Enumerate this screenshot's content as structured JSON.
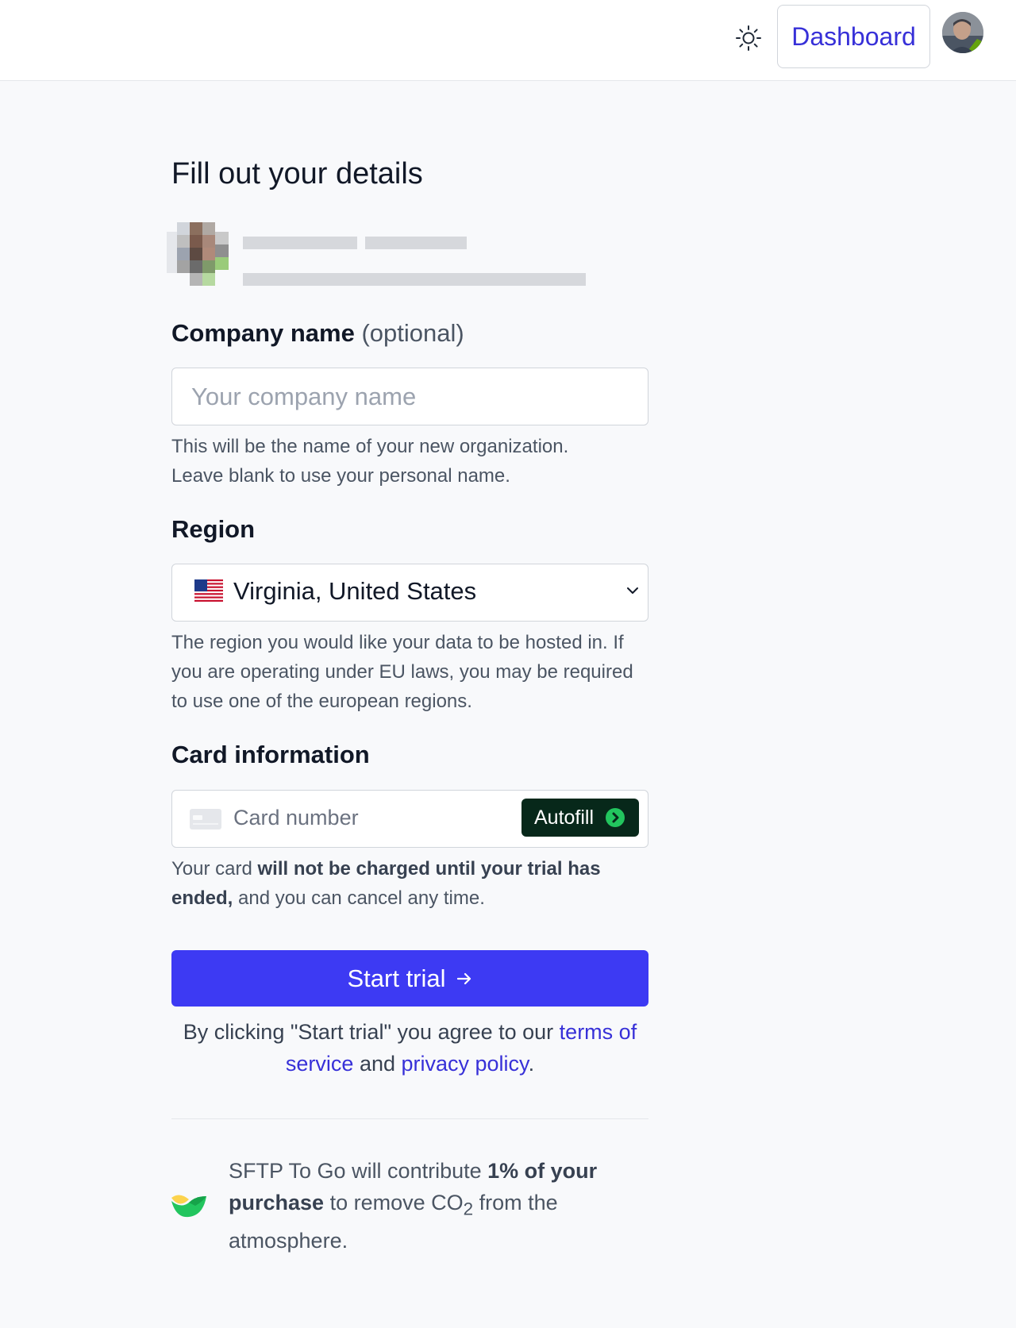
{
  "header": {
    "theme_toggle_icon": "sun-icon",
    "dashboard_label": "Dashboard",
    "avatar_icon": "user-avatar"
  },
  "page": {
    "title": "Fill out your details"
  },
  "company": {
    "label": "Company name",
    "optional": "(optional)",
    "placeholder": "Your company name",
    "value": "",
    "help_line1": "This will be the name of your new organization.",
    "help_line2": "Leave blank to use your personal name."
  },
  "region": {
    "label": "Region",
    "flag_icon": "us-flag-icon",
    "selected": "Virginia, United States",
    "help": "The region you would like your data to be hosted in. If you are operating under EU laws, you may be required to use one of the european regions."
  },
  "card": {
    "label": "Card information",
    "placeholder": "Card number",
    "autofill_label": "Autofill",
    "help_pre": "Your card ",
    "help_bold": "will not be charged until your trial has ended,",
    "help_post": " and you can cancel any time."
  },
  "cta": {
    "start_label": "Start trial",
    "arrow": "→"
  },
  "terms": {
    "pre": "By clicking \"Start trial\" you agree to our ",
    "terms_link": "terms of service",
    "mid": " and ",
    "privacy_link": "privacy policy",
    "post": "."
  },
  "climate": {
    "pre": "SFTP To Go will contribute ",
    "bold": "1% of your purchase",
    "mid": " to remove CO",
    "sub": "2",
    "post": " from the atmosphere."
  },
  "colors": {
    "accent": "#3d3af3",
    "link": "#3730d8",
    "autofill_bg": "#07281a",
    "autofill_icon": "#22c55e"
  }
}
